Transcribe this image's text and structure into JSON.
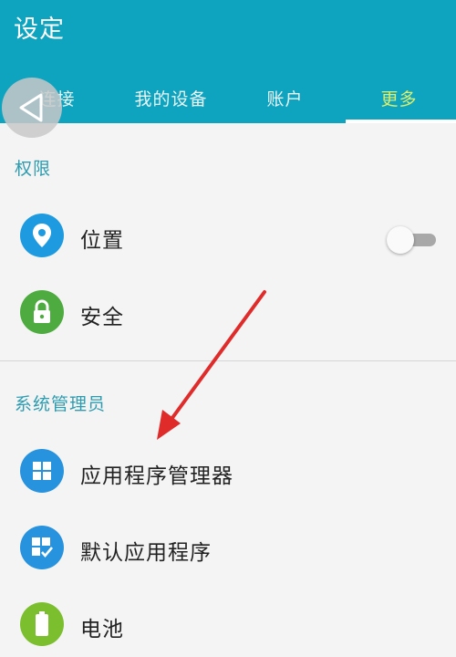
{
  "header": {
    "title": "设定",
    "tabs": [
      {
        "label": "连接",
        "active": false
      },
      {
        "label": "我的设备",
        "active": false
      },
      {
        "label": "账户",
        "active": false
      },
      {
        "label": "更多",
        "active": true
      }
    ]
  },
  "sections": [
    {
      "title": "权限",
      "items": [
        {
          "label": "位置",
          "icon": "location-pin-icon",
          "icon_color": "#1e9be0",
          "has_toggle": true,
          "toggle_on": false
        },
        {
          "label": "安全",
          "icon": "lock-icon",
          "icon_color": "#4eab3f"
        }
      ]
    },
    {
      "title": "系统管理员",
      "items": [
        {
          "label": "应用程序管理器",
          "icon": "grid-icon",
          "icon_color": "#2792de"
        },
        {
          "label": "默认应用程序",
          "icon": "grid-check-icon",
          "icon_color": "#2792de"
        },
        {
          "label": "电池",
          "icon": "battery-icon",
          "icon_color": "#7bbf2e"
        }
      ]
    }
  ],
  "colors": {
    "header_bg": "#0ea3bf",
    "active_tab": "#d9ef6d",
    "section_title": "#2e9cb0",
    "annotation_arrow": "#e02b2b"
  }
}
